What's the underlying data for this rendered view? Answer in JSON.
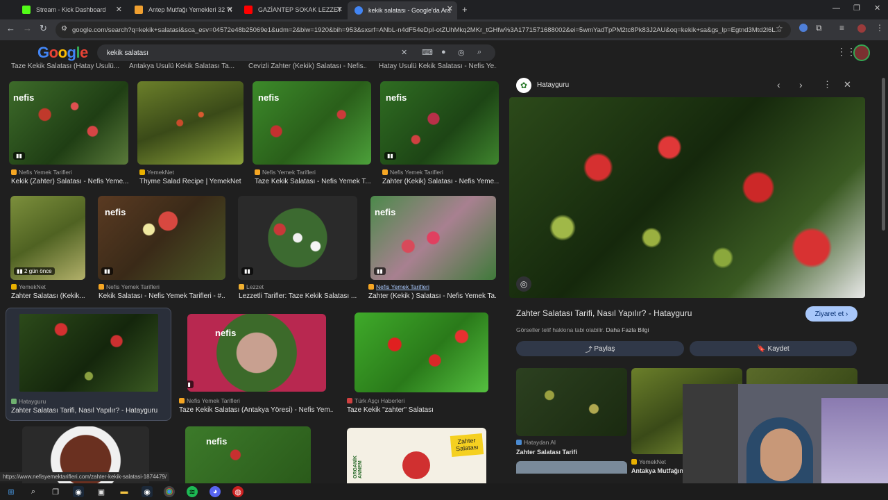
{
  "tabs": [
    {
      "title": "Stream - Kick Dashboard",
      "color": "#53fc18"
    },
    {
      "title": "Antep Mutfağı Yemekleri 32 Yo",
      "color": "#f0a030"
    },
    {
      "title": "GAZİANTEP SOKAK LEZZETLERİ",
      "color": "#ff0000"
    },
    {
      "title": "kekik salatası - Google'da Ara",
      "color": "#4285f4"
    }
  ],
  "url": "google.com/search?q=kekik+salatasi&sca_esv=04572e48b25069e1&udm=2&biw=1920&bih=953&sxsrf=ANbL-n4dF54eDpI-otZUhMkq2MKr_tGHfw%3A1771571688002&ei=5wmYadTpPM2tc8Pk83J2AU&oq=kekik+sa&gs_lp=Egtnd3Mtd2l6L...",
  "search": {
    "logo": "Google",
    "query": "kekik salatası"
  },
  "top_captions": [
    "Taze Kekik Salatası (Hatay Usulü...",
    "Antakya Usulü Kekik Salatası Ta...",
    "Cevizli Zahter (Kekik) Salatası - Nefis...",
    "Hatay Usulü Kekik Salatası - Nefis Ye..."
  ],
  "results": [
    {
      "source": "Nefis Yemek Tarifleri",
      "caption": "Kekik (Zahter) Salatası - Nefis Yeme...",
      "badge": "▮▮",
      "favcolor": "#f5a623"
    },
    {
      "source": "YemekNet",
      "caption": "Thyme Salad Recipe | YemekNet",
      "badge": "",
      "favcolor": "#e8b000"
    },
    {
      "source": "Nefis Yemek Tarifleri",
      "caption": "Taze Kekik Salatası - Nefis Yemek T...",
      "badge": "",
      "favcolor": "#f5a623"
    },
    {
      "source": "Nefis Yemek Tarifleri",
      "caption": "Zahter (Kekik) Salatası - Nefis Yeme...",
      "badge": "▮▮",
      "favcolor": "#f5a623"
    },
    {
      "source": "YemekNet",
      "caption": "Zahter Salatası (Kekik...",
      "badge": "▮▮ 2 gün önce",
      "favcolor": "#e8b000"
    },
    {
      "source": "Nefis Yemek Tarifleri",
      "caption": "Kekik Salatası - Nefis Yemek Tarifleri - #...",
      "badge": "▮▮",
      "favcolor": "#f5a623"
    },
    {
      "source": "Lezzet",
      "caption": "Lezzetli Tarifler: Taze Kekik Salatası ...",
      "badge": "▮▮",
      "favcolor": "#f0b030"
    },
    {
      "source": "Nefis Yemek Tarifleri",
      "caption": "Zahter (Kekik ) Salatası - Nefis Yemek Ta...",
      "badge": "▮▮",
      "favcolor": "#f5a623"
    },
    {
      "source": "Hatayguru",
      "caption": "Zahter Salatası Tarifi, Nasıl Yapılır? - Hatayguru",
      "badge": "",
      "favcolor": "#6fb06f"
    },
    {
      "source": "Nefis Yemek Tarifleri",
      "caption": "Taze Kekik Salatası (Antakya Yöresi) - Nefis Yem...",
      "badge": "▮▮",
      "favcolor": "#f5a623"
    },
    {
      "source": "Türk Aşçı Haberleri",
      "caption": "Taze Kekik \"zahter\" Salatası",
      "badge": "",
      "favcolor": "#d04040"
    }
  ],
  "panel": {
    "site": "Hatayguru",
    "title": "Zahter Salatası Tarifi, Nasıl Yapılır? - Hatayguru",
    "visit": "Ziyaret et",
    "copyright": "Görseller telif hakkına tabi olabilir.",
    "more_info": "Daha Fazla Bilgi",
    "share": "Paylaş",
    "save": "Kaydet",
    "related": [
      {
        "source": "Hataydan Al",
        "caption": "Zahter Salatası Tarifi"
      },
      {
        "source": "YemekNet",
        "caption": "Antakya Mutfağında..."
      }
    ]
  },
  "zahter_label": "Zahter Salatası",
  "organik_label": "ORGANİK ANNEM",
  "status_url": "https://www.nefisyemektarifleri.com/zahter-kekik-salatasi-1874479/"
}
